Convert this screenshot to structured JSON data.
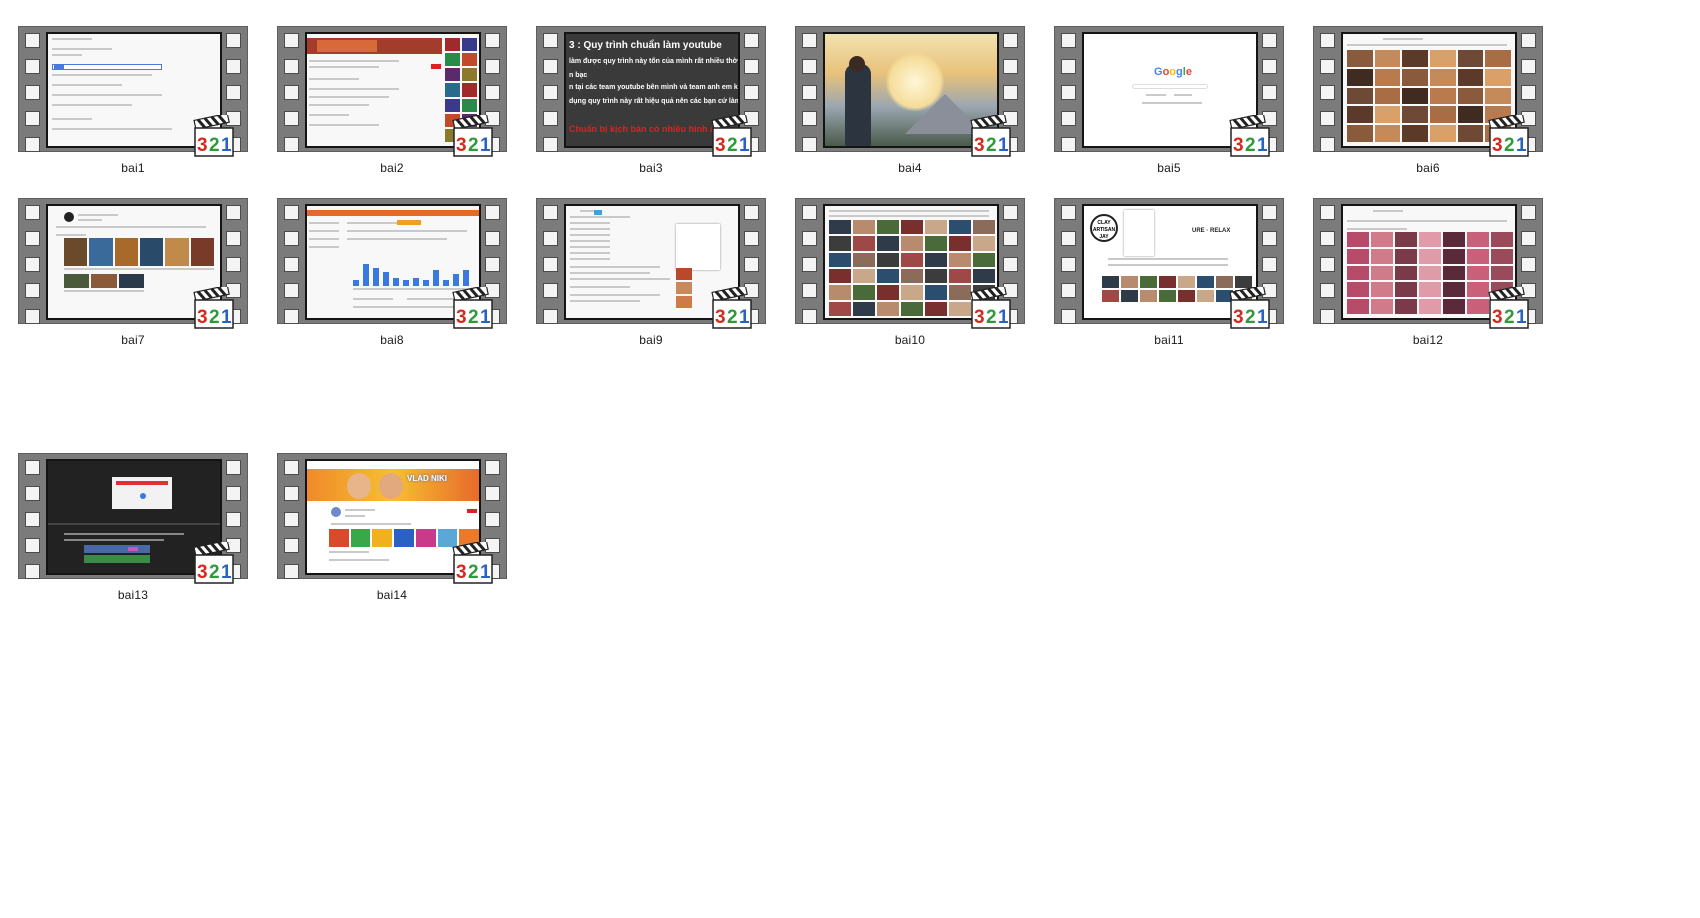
{
  "folder": {
    "view": "large-icons",
    "items": [
      {
        "name": "bai1",
        "icon": "video-file-icon"
      },
      {
        "name": "bai2",
        "icon": "video-file-icon"
      },
      {
        "name": "bai3",
        "icon": "video-file-icon",
        "preview_text": {
          "title": "3 : Quy trình chuẩn làm youtube",
          "line1": "làm được quy trình này tốn của mình rất nhiều thời gian",
          "line2": "n bạc",
          "line3": "n tại các team youtube bên mình và team anh em khác c",
          "line4": "dụng quy trình này rất hiệu quả nên các bạn cứ làm the",
          "line5": "Chuẩn bị kịch bản có nhiều hình ảnh"
        }
      },
      {
        "name": "bai4",
        "icon": "video-file-icon"
      },
      {
        "name": "bai5",
        "icon": "video-file-icon",
        "preview_text": {
          "logo": "Google"
        }
      },
      {
        "name": "bai6",
        "icon": "video-file-icon"
      },
      {
        "name": "bai7",
        "icon": "video-file-icon"
      },
      {
        "name": "bai8",
        "icon": "video-file-icon"
      },
      {
        "name": "bai9",
        "icon": "video-file-icon"
      },
      {
        "name": "bai10",
        "icon": "video-file-icon"
      },
      {
        "name": "bai11",
        "icon": "video-file-icon",
        "preview_text": {
          "headline": "URE · RELAX",
          "badge": "CLAY ARTISAN JAY"
        }
      },
      {
        "name": "bai12",
        "icon": "video-file-icon"
      },
      {
        "name": "bai13",
        "icon": "video-file-icon"
      },
      {
        "name": "bai14",
        "icon": "video-file-icon",
        "preview_text": {
          "banner": "VLAD NIKI"
        }
      }
    ],
    "badge_icon": "mpc-hc-clapperboard-321-icon",
    "badge_text": "321",
    "colors": {
      "filmstrip": "#7b7b7b",
      "badge_red": "#d42a1e",
      "badge_green": "#2f9a3a",
      "badge_blue": "#2a62c4",
      "youtube_red": "#e02020"
    }
  }
}
